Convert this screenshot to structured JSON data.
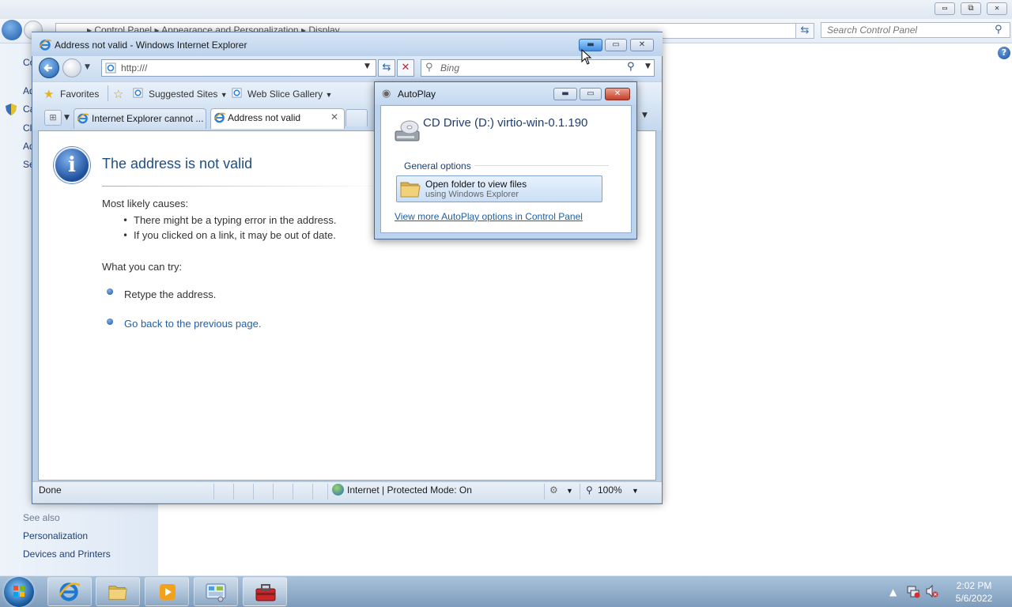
{
  "control_panel": {
    "breadcrumb": [
      "Control Panel",
      "Appearance and Personalization",
      "Display"
    ],
    "breadcrumb_sep": "▸",
    "search_placeholder": "Search Control Panel",
    "window_buttons": {
      "minimize": "▭",
      "restore": "⧉",
      "close": "✕"
    },
    "sidebar_stubs": [
      "Co",
      "Ad",
      "Ca",
      "Cl",
      "Ad",
      "Se"
    ],
    "see_also": "See also",
    "links": [
      "Personalization",
      "Devices and Printers"
    ],
    "help": "?"
  },
  "ie": {
    "title": "Address not valid - Windows Internet Explorer",
    "address": "http:///",
    "search_placeholder": "Bing",
    "favorites_bar": {
      "favorites": "Favorites",
      "suggested_sites": "Suggested Sites",
      "web_slice_gallery": "Web Slice Gallery"
    },
    "tabs": [
      {
        "label": "Internet Explorer cannot ...",
        "active": false
      },
      {
        "label": "Address not valid",
        "active": true
      }
    ],
    "tab_close": "✕",
    "page": {
      "heading": "The address is not valid",
      "causes_title": "Most likely causes:",
      "causes": [
        "There might be a typing error in the address.",
        "If you clicked on a link, it may be out of date."
      ],
      "try_title": "What you can try:",
      "try_items": [
        "Retype the address."
      ],
      "back_link": "Go back to the previous page."
    },
    "status": {
      "text": "Done",
      "zone": "Internet | Protected Mode: On",
      "zoom": "100%"
    }
  },
  "autoplay": {
    "title": "AutoPlay",
    "drive": "CD Drive (D:) virtio-win-0.1.190",
    "group_label": "General options",
    "option_title": "Open folder to view files",
    "option_subtitle": "using Windows Explorer",
    "more_link": "View more AutoPlay options in Control Panel"
  },
  "taskbar": {
    "time": "2:02 PM",
    "date": "5/6/2022",
    "buttons": [
      "internet-explorer",
      "windows-explorer",
      "media-player",
      "control-panel",
      "toolbox"
    ]
  },
  "colors": {
    "link": "#1f5fa8",
    "heading": "#1f4d85",
    "chrome": "#bcd0e8"
  }
}
